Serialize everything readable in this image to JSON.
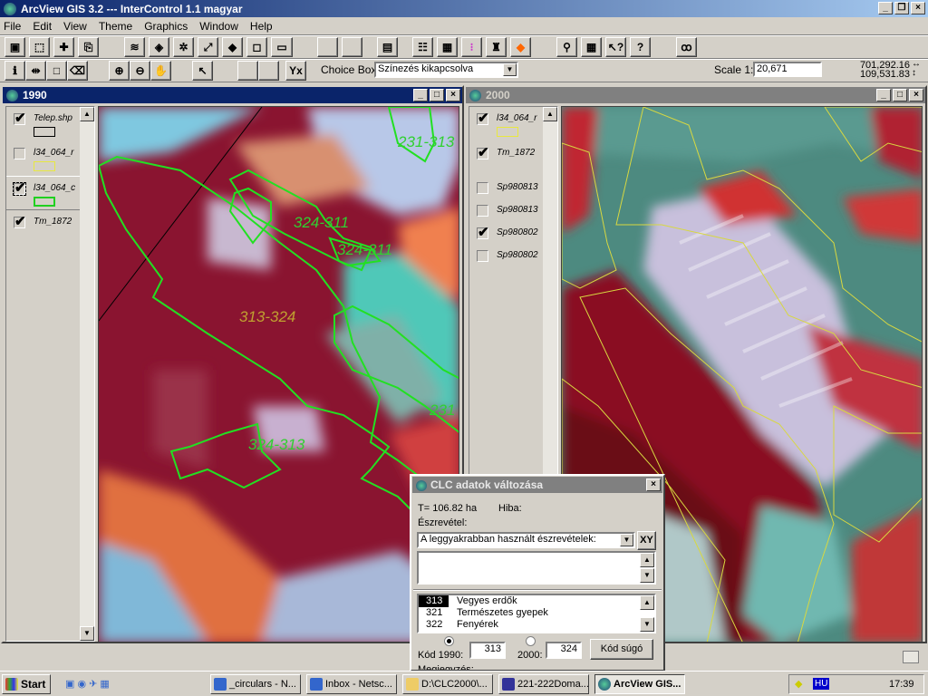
{
  "app": {
    "title": "ArcView GIS 3.2 --- InterControl 1.1 magyar"
  },
  "menu": [
    "File",
    "Edit",
    "View",
    "Theme",
    "Graphics",
    "Window",
    "Help"
  ],
  "toolbar2": {
    "choice_box_label": "Choice Box",
    "choice_box_value": "Színezés kikapcsolva",
    "scale_label": "Scale 1:",
    "scale_value": "20,671",
    "coord_x": "701,292.16",
    "coord_y": "109,531.83"
  },
  "view1990": {
    "title": "1990",
    "layers": [
      {
        "name": "Telep.shp",
        "checked": true,
        "symbol_color": "#000000"
      },
      {
        "name": "l34_064_r",
        "checked": false,
        "symbol_color": "#e8e840"
      },
      {
        "name": "l34_064_c",
        "checked": true,
        "symbol_color": "#20d020",
        "active": true
      },
      {
        "name": "Tm_1872",
        "checked": true
      }
    ],
    "map_labels": [
      "231-313",
      "324-311",
      "324-311",
      "313-324",
      "324-313",
      "231"
    ]
  },
  "view2000": {
    "title": "2000",
    "layers": [
      {
        "name": "l34_064_r",
        "checked": true,
        "symbol_color": "#e8e840"
      },
      {
        "name": "Tm_1872",
        "checked": true
      },
      {
        "name": "Sp980813",
        "checked": false
      },
      {
        "name": "Sp980813",
        "checked": false
      },
      {
        "name": "Sp980802",
        "checked": true
      },
      {
        "name": "Sp980802",
        "checked": false
      }
    ]
  },
  "dialog": {
    "title": "CLC adatok változása",
    "area": "T= 106.82 ha",
    "error_label": "Hiba:",
    "remark_label": "Észrevétel:",
    "remarks_combo": "A leggyakrabban használt észrevételek:",
    "xy_button": "XY",
    "codes": [
      {
        "code": "313",
        "name": "Vegyes erdők",
        "selected": true
      },
      {
        "code": "321",
        "name": "Természetes gyepek"
      },
      {
        "code": "322",
        "name": "Fenyérek"
      }
    ],
    "code1990_label": "Kód 1990:",
    "code1990": "313",
    "code2000_label": "2000:",
    "code2000": "324",
    "help_button": "Kód súgó",
    "bottom_label": "Megjegyzés:"
  },
  "taskbar": {
    "start": "Start",
    "tasks": [
      "_circulars - N...",
      "Inbox - Netsc...",
      "D:\\CLC2000\\...",
      "221-222Doma...",
      "ArcView GIS..."
    ],
    "lang": "HU",
    "clock": "17:39"
  }
}
